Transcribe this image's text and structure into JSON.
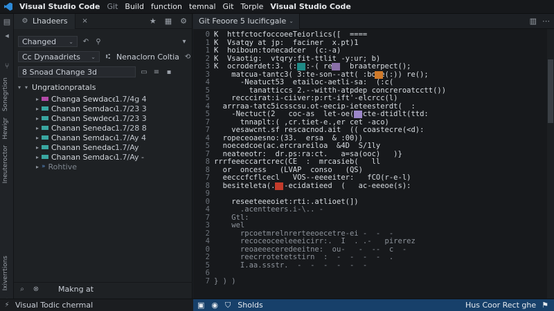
{
  "titlebar": {
    "app": "Visual Studio Code",
    "menu": [
      "Git",
      "Build",
      "function",
      "temnal",
      "Git",
      "Torple",
      "Visual Studio Code"
    ]
  },
  "activity": {
    "labels": [
      "Sonegrtion",
      "Hewigr",
      "Ineuteroctor",
      "Ixiverrtions"
    ]
  },
  "sidebar": {
    "tab_label": "Lhadeers",
    "changed_label": "Changed",
    "row2_left": "Cc Dynaadriets",
    "row2_right": "Nenaclorn Coltia",
    "row3_label": "8 Snoad Change 3d",
    "section_title": "Ungrationpratals",
    "items": [
      {
        "name": "Changa",
        "sub": "Sewdacec",
        "date": "1.7/4g 4"
      },
      {
        "name": "Chanan",
        "sub": "Semdaces",
        "date": "1.7/23 3"
      },
      {
        "name": "Chanan",
        "sub": "Sewdeces",
        "date": "1.7/23 3"
      },
      {
        "name": "Chanan",
        "sub": "Senedaces",
        "date": "1.7/28 8"
      },
      {
        "name": "Chanan",
        "sub": "Semdaces",
        "date": "1.7/Ay 4"
      },
      {
        "name": "Chanan",
        "sub": "Senedaces",
        "date": "1.7/Ay"
      },
      {
        "name": "Chanan",
        "sub": "Semdaces",
        "date": "1.7/Ay -"
      }
    ],
    "extra_item": "Rohtive",
    "bottom_label": "Makng at"
  },
  "editor": {
    "tab_label": "Git Feoore 5 Iucificgale",
    "line_numbers": [
      "0",
      "1",
      "1",
      "2",
      "3",
      "3",
      "4",
      "5",
      "5",
      "4",
      "5",
      "7",
      "7",
      "4",
      "5",
      "7",
      "8",
      "8",
      "7",
      "8",
      "9",
      "0",
      "4",
      "7",
      "3",
      "2",
      "4",
      "0",
      "2",
      "5",
      "6",
      "7",
      "8",
      "9",
      "6",
      "7",
      "8"
    ],
    "lines": [
      "K  httfctocfoccoeeTeiorlics([  ====",
      "K  Vsatqy at jp:  faciner  x.pt)1",
      "K  hoiboun:tonecadcer  (c:-a)",
      "K  Vsaotig:  vtqry:fit-ttlit -y:ur; b)",
      "K  ocroderdet:3. (:  :-( ret   braaterpect();",
      "    matcua-tantc3( 3:te-son--att( :bote(:)) re();",
      "      -Neatuct53  etailoc-aetli-sa:  (:c(",
      "        tanatticcs 2.--witth-atpdep concreroatcctt())",
      "    recccirat:i-ciiver:p:rt-ift'-elcrcc(l)",
      "  arrraa-tatc5icsscsu.ot-eecip-ieteesterdt(  :",
      "    -Nectuct(2   coc-as  let-oe(aecte-dtidlt(ttd:",
      "      tnnaplt:( ,cr.tiet-e.,er cet -aco)",
      "    vesawcnt.sf rescacnod.ait  (( coastecre(<d):",
      "  ropeceoaesno:(33.  ersa  & :00))",
      "  noecedcoe(ac.ercrareiloa  &4D  S/1ly",
      "  neateeotr:  dr.ps:ra:ct.   a=sa(ooc)   )}",
      "rrrfeeeccartcrec(CE  :  mrcasieb(   ll",
      "  or  oncess   (LVAP  conso   (QS)",
      "  eecccfcflcecl   VOS--eeeeiter:   fCO(r-e-l)",
      "  besiteleta(.  -ecidatieed  (   ac-eeeoe(s):",
      "",
      "    reseeteeeoiet:rti:.atlioet(])",
      "      .acentteers.i-\\.. -",
      "    Gtl:",
      "    wel",
      "      rpcoetmrelnrerteeoecetre-ei -  -  -",
      "      recoceoceeleeeicirr:.  I  . .-   pirerez",
      "      reoaeeeceredeeitne:  ou-   -  --  c  -",
      "      reecrrotetetstirn  :  -  -  -  -  .",
      "      I.aa.ssstr.  -  -  -  -  -  -",
      "",
      "} ) )"
    ]
  },
  "status": {
    "left_label": "Visual Todic chermal",
    "right_label": "Sholds",
    "right_end": "Hus Coor Rect ghe"
  },
  "colors": {
    "accent": "#17406a",
    "swatch_teal": "#1f8a86",
    "swatch_purple": "#8a6fa8",
    "swatch_orange": "#d07a2a",
    "swatch_red": "#c23b2b",
    "swatch_violet": "#9b86c9"
  }
}
